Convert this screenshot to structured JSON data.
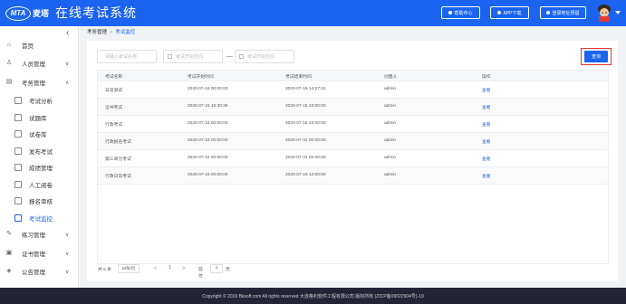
{
  "header": {
    "logo_text": "MTA",
    "logo_suffix": "麦塔",
    "title": "在线考试系统",
    "buttons": [
      {
        "label": "帮助中心",
        "icon": "help-icon"
      },
      {
        "label": "APP下载",
        "icon": "download-icon"
      },
      {
        "label": "登录地址预留",
        "icon": "user-icon"
      }
    ],
    "avatar_icon": "avatar-icon"
  },
  "sidebar": {
    "collapse_icon": "chevron-left-icon",
    "items": [
      {
        "label": "首页",
        "icon": "home-icon"
      },
      {
        "label": "人员管理",
        "icon": "person-icon",
        "chevron": "∨"
      },
      {
        "label": "考务管理",
        "icon": "document-icon",
        "chevron": "∧"
      }
    ],
    "subitems": [
      {
        "label": "考试分析"
      },
      {
        "label": "试题库"
      },
      {
        "label": "试卷库"
      },
      {
        "label": "发布考试"
      },
      {
        "label": "成绩管理"
      },
      {
        "label": "人工阅卷"
      },
      {
        "label": "报名审核"
      },
      {
        "label": "考试监控",
        "active": true
      }
    ],
    "bottom_items": [
      {
        "label": "练习管理",
        "icon": "practice-icon",
        "chevron": "∨"
      },
      {
        "label": "证书管理",
        "icon": "certificate-icon",
        "chevron": "∨"
      },
      {
        "label": "公告管理",
        "icon": "announcement-icon",
        "chevron": "∨"
      }
    ]
  },
  "breadcrumb": {
    "parent": "考务管理",
    "separator": ">",
    "current": "考试监控"
  },
  "filters": {
    "name_placeholder": "请输入考试名称",
    "start_placeholder": "考试开始时间",
    "dash": "—",
    "end_placeholder": "考试开始时间",
    "query_label": "查询"
  },
  "table": {
    "headers": [
      "考试名称",
      "考试开始时间",
      "考试结束时间",
      "创建人",
      "操作"
    ],
    "rows": [
      [
        "日常测试",
        "2020-07-16 00:00:00",
        "2020-07-16 14:27:24",
        "admin",
        "查看"
      ],
      [
        "证书考试",
        "2020-07-15 16:30:36",
        "2020-07-15 23:00:00",
        "admin",
        "查看"
      ],
      [
        "行政考试",
        "2020-07-15 00:00:00",
        "2020-07-15 23:00:00",
        "admin",
        "查看"
      ],
      [
        "行政报名考试",
        "2020-07-16 00:00:00",
        "2020-07-31 00:00:00",
        "admin",
        "查看"
      ],
      [
        "第三单元考试",
        "2020-07-15 00:00:00",
        "2020-07-31 00:00:00",
        "admin",
        "查看"
      ],
      [
        "行政日常考试",
        "2020-07-15 00:00:00",
        "2020-07-15 12:00:00",
        "admin",
        "查看"
      ]
    ]
  },
  "pagination": {
    "total": "共 6 条",
    "page_size": "10条/页",
    "prev": "<",
    "current": "1",
    "next": ">",
    "goto_label": "前往",
    "goto_value": "1",
    "goto_suffix": "页"
  },
  "footer": {
    "text": "Copyright © 2019 Bksoft.com All rights reserved 大连格利软件工程有限公司 版权所有 (ZICP备09022904号)-19"
  }
}
